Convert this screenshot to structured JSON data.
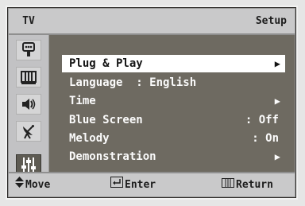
{
  "header": {
    "left_label": "TV",
    "title": "Setup"
  },
  "sidebar": {
    "items": [
      {
        "icon": "input-icon",
        "active": false
      },
      {
        "icon": "picture-icon",
        "active": false
      },
      {
        "icon": "sound-icon",
        "active": false
      },
      {
        "icon": "channel-antenna-icon",
        "active": false
      },
      {
        "icon": "setup-sliders-icon",
        "active": true
      }
    ]
  },
  "menu": {
    "items": [
      {
        "label": "Plug & Play",
        "value": "",
        "submenu": true,
        "selected": true
      },
      {
        "label": "Language  : English",
        "value": "",
        "submenu": false,
        "selected": false
      },
      {
        "label": "Time",
        "value": "",
        "submenu": true,
        "selected": false
      },
      {
        "label": "Blue Screen",
        "value": ": Off",
        "submenu": false,
        "selected": false
      },
      {
        "label": "Melody",
        "value": ": On",
        "submenu": false,
        "selected": false
      },
      {
        "label": "Demonstration",
        "value": "",
        "submenu": true,
        "selected": false
      }
    ]
  },
  "footer": {
    "move_label": "Move",
    "enter_label": "Enter",
    "return_label": "Return"
  },
  "colors": {
    "panel": "#cfcfd0",
    "content": "#6e6a61",
    "highlight": "#ffffff",
    "text_light": "#fbfbfb"
  }
}
